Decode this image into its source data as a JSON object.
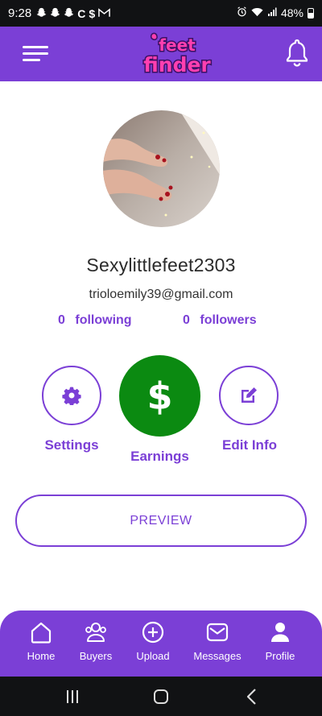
{
  "status_bar": {
    "time": "9:28",
    "left_icons": [
      "snapchat-icon",
      "snapchat-icon",
      "snapchat-icon",
      "c-app-icon",
      "cashapp-icon",
      "gmail-icon"
    ],
    "c_glyph": "C",
    "cash_glyph": "$",
    "battery": "48%"
  },
  "header": {
    "logo_top": "feet",
    "logo_bottom": "finder",
    "accent": "#7b3fd6"
  },
  "profile": {
    "username": "Sexylittlefeet2303",
    "email": "trioloemily39@gmail.com",
    "following_count": "0",
    "following_label": "following",
    "followers_count": "0",
    "followers_label": "followers"
  },
  "actions": {
    "settings_label": "Settings",
    "earnings_label": "Earnings",
    "earnings_symbol": "$",
    "edit_label": "Edit Info",
    "earnings_color": "#0b8a11"
  },
  "preview_label": "PREVIEW",
  "bottom_nav": {
    "items": [
      {
        "label": "Home",
        "icon": "home-icon"
      },
      {
        "label": "Buyers",
        "icon": "buyers-icon"
      },
      {
        "label": "Upload",
        "icon": "upload-icon"
      },
      {
        "label": "Messages",
        "icon": "messages-icon"
      },
      {
        "label": "Profile",
        "icon": "profile-icon"
      }
    ]
  }
}
